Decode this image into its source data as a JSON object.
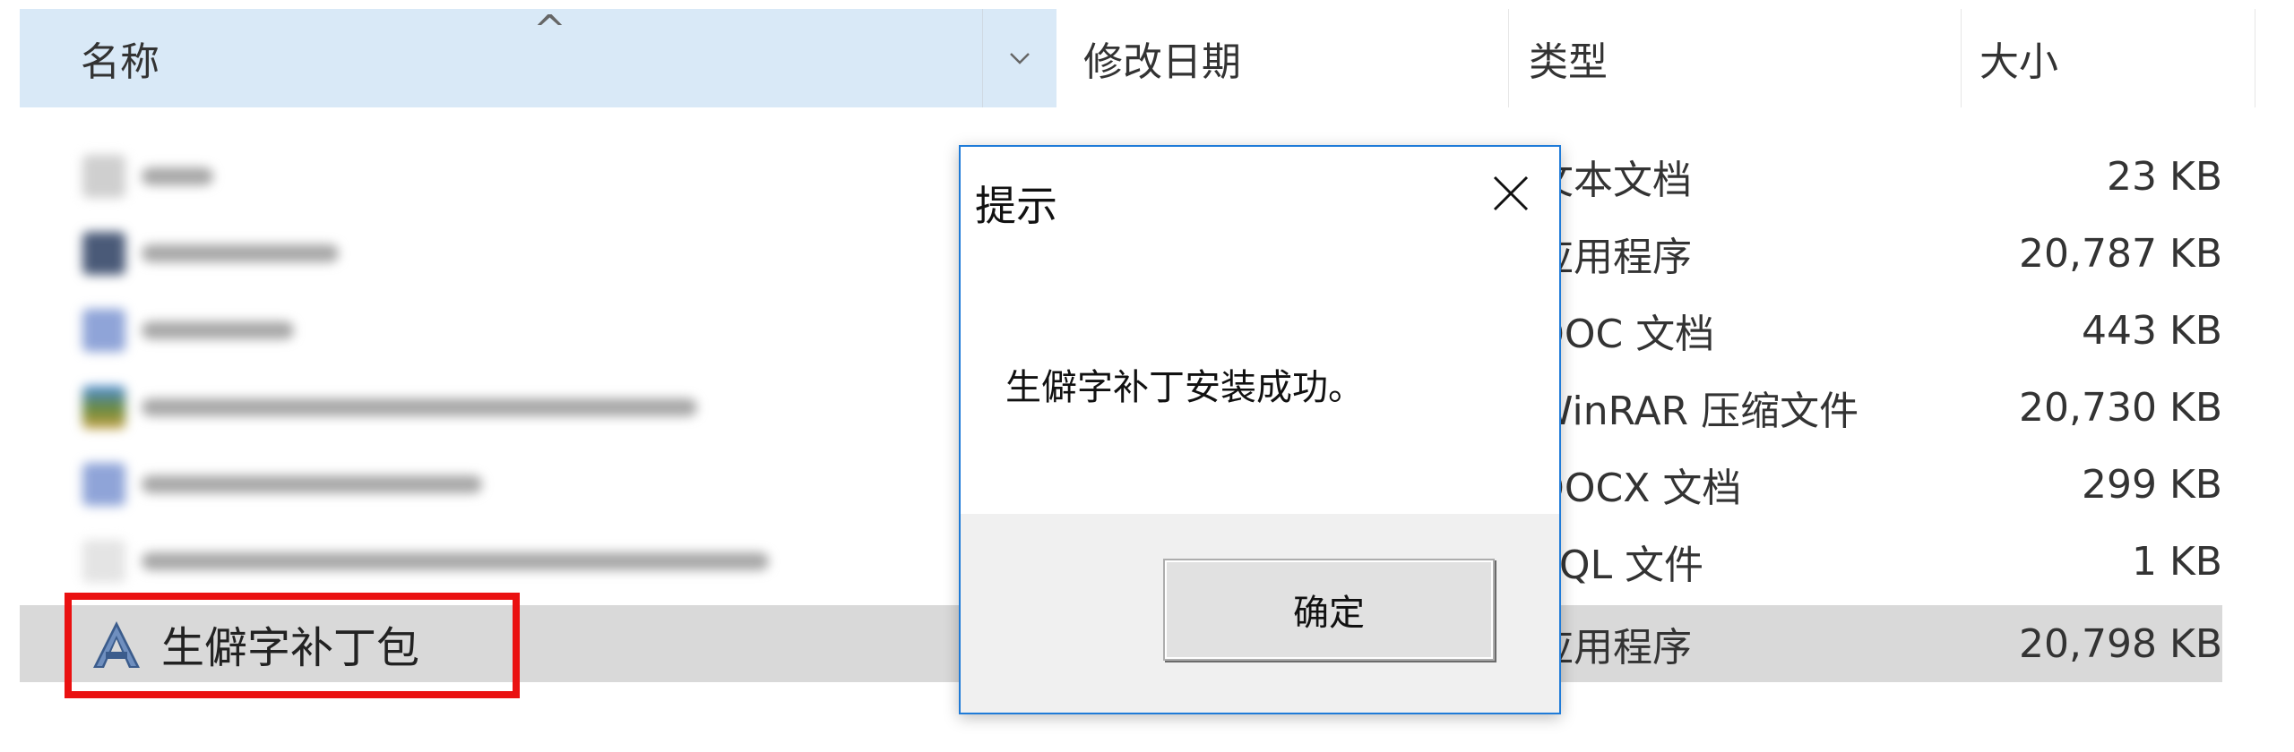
{
  "columns": {
    "name": "名称",
    "date": "修改日期",
    "type": "类型",
    "size": "大小"
  },
  "files": [
    {
      "type": "文本文档",
      "size": "23 KB"
    },
    {
      "type": "应用程序",
      "size": "20,787 KB"
    },
    {
      "type": "DOC 文档",
      "size": "443 KB"
    },
    {
      "type": "WinRAR 压缩文件",
      "size": "20,730 KB"
    },
    {
      "type": "DOCX 文档",
      "size": "299 KB"
    },
    {
      "type": "SQL 文件",
      "size": "1 KB"
    },
    {
      "name": "生僻字补丁包",
      "type": "应用程序",
      "size": "20,798 KB",
      "selected": true
    }
  ],
  "dialog": {
    "title": "提示",
    "message": "生僻字补丁安装成功。",
    "ok_label": "确定"
  },
  "colors": {
    "header_bg": "#d9e9f7",
    "selected_row": "#d9d9d9",
    "highlight_border": "#ea1111",
    "dialog_border": "#1f7bd8"
  }
}
